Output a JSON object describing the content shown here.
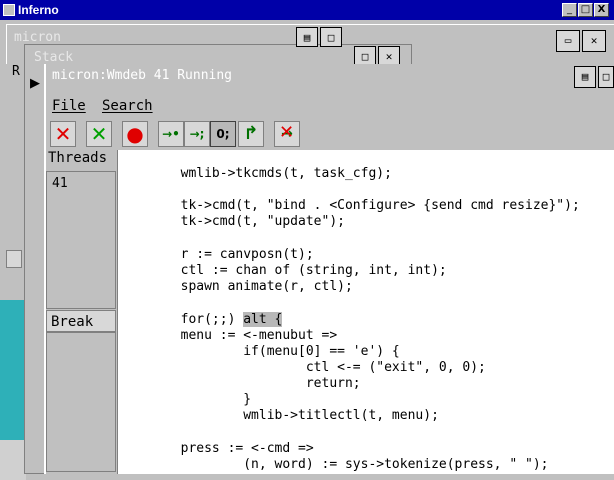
{
  "outer": {
    "title": "Inferno",
    "btn_min": "_",
    "btn_max": "□",
    "btn_close": "X"
  },
  "micron": {
    "title": "micron",
    "r_label": "R"
  },
  "stack": {
    "title": "Stack"
  },
  "main": {
    "title": "micron:Wmdeb 41 Running",
    "menu": {
      "file": "File",
      "search": "Search"
    }
  },
  "toolbar": {
    "kill": "✕",
    "detach": "✕",
    "stop": "●",
    "step_into": "→•",
    "step_over": "→;",
    "step_out": "0;",
    "run": "↱",
    "clear_break": "→"
  },
  "colors": {
    "title_bg": "#0000a8",
    "chrome": "#c0c0c0",
    "kill_red": "#e00000",
    "detach_green": "#00a000"
  },
  "threads": {
    "label": "Threads",
    "items": [
      "41"
    ]
  },
  "break": {
    "label": "Break"
  },
  "code": {
    "lines": [
      "        wmlib->tkcmds(t, task_cfg);",
      "",
      "        tk->cmd(t, \"bind . <Configure> {send cmd resize}\");",
      "        tk->cmd(t, \"update\");",
      "",
      "        r := canvposn(t);",
      "        ctl := chan of (string, int, int);",
      "        spawn animate(r, ctl);",
      "",
      "        for(;;) ",
      "        menu := <-menubut =>",
      "                if(menu[0] == 'e') {",
      "                        ctl <-= (\"exit\", 0, 0);",
      "                        return;",
      "                }",
      "                wmlib->titlectl(t, menu);",
      "",
      "        press := <-cmd =>",
      "                (n, word) := sys->tokenize(press, \" \");"
    ],
    "highlight": "alt {"
  }
}
